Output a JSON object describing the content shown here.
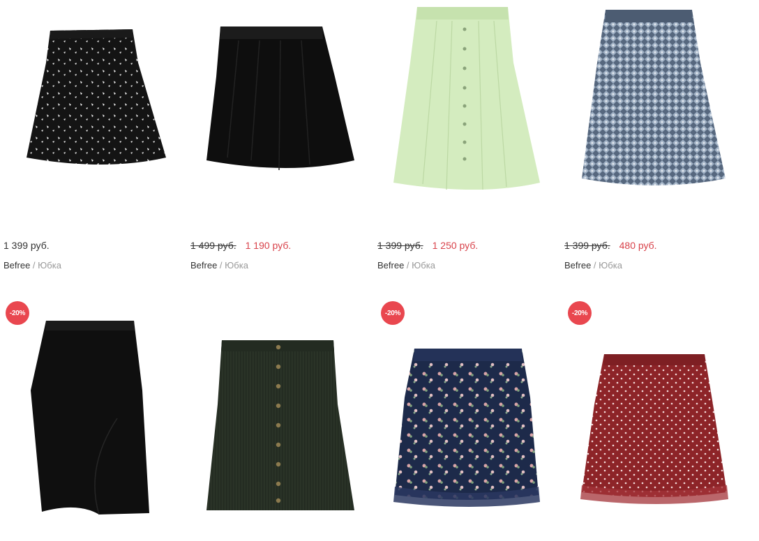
{
  "products": [
    {
      "price": "1 399 руб.",
      "old_price": "",
      "new_price": "",
      "brand": "Befree",
      "separator": " / ",
      "category": "Юбка",
      "badge": "",
      "image": "black-floral-skater-skirt"
    },
    {
      "price": "",
      "old_price": "1 499 руб.",
      "new_price": "1 190 руб.",
      "brand": "Befree",
      "separator": " / ",
      "category": "Юбка",
      "badge": "",
      "image": "black-pleated-skater-skirt"
    },
    {
      "price": "",
      "old_price": "1 399 руб.",
      "new_price": "1 250 руб.",
      "brand": "Befree",
      "separator": " / ",
      "category": "Юбка",
      "badge": "",
      "image": "mint-button-midi-skirt"
    },
    {
      "price": "",
      "old_price": "1 399 руб.",
      "new_price": "480 руб.",
      "brand": "Befree",
      "separator": " / ",
      "category": "Юбка",
      "badge": "",
      "image": "blue-print-midi-skirt"
    },
    {
      "badge": "-20%",
      "image": "black-pencil-skirt"
    },
    {
      "badge": "",
      "image": "olive-corduroy-button-skirt"
    },
    {
      "badge": "-20%",
      "image": "navy-floral-chiffon-skirt"
    },
    {
      "badge": "-20%",
      "image": "red-dot-chiffon-skirt"
    }
  ],
  "colors": {
    "sale": "#d8424a",
    "badge": "#e9474f",
    "muted": "#999999",
    "text": "#333333"
  }
}
